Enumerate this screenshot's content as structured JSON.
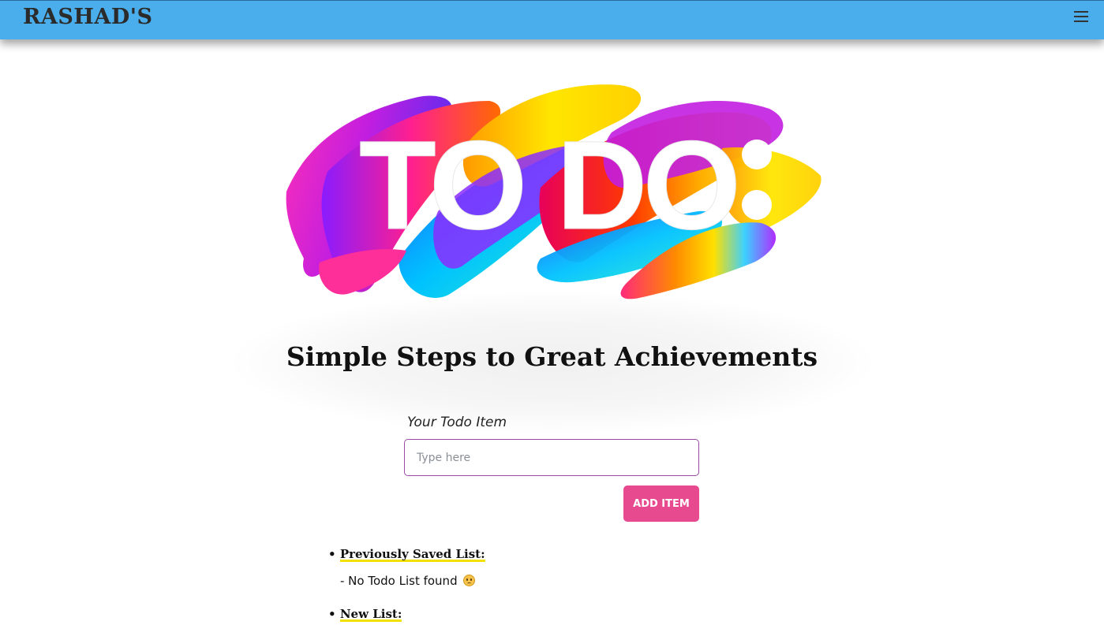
{
  "navbar": {
    "brand": "RASHAD'S",
    "menu_icon": "hamburger-menu-icon",
    "color": "#4aaeec"
  },
  "hero": {
    "image_text": "TO DO:"
  },
  "headline": "Simple Steps to Great Achievements",
  "form": {
    "label": "Your Todo Item",
    "placeholder": "Type here",
    "value": "",
    "button_label": "ADD ITEM",
    "button_color": "#e84a8f",
    "input_border_color": "#9b4aa5"
  },
  "lists": {
    "previous_prefix": "•",
    "previous_title": "Previously Saved List:",
    "empty_message": "- No Todo List found",
    "empty_icon": "sad-face-emoji-icon",
    "new_prefix": "•",
    "new_title": "New List:"
  },
  "accent_highlight": "#f2e000"
}
